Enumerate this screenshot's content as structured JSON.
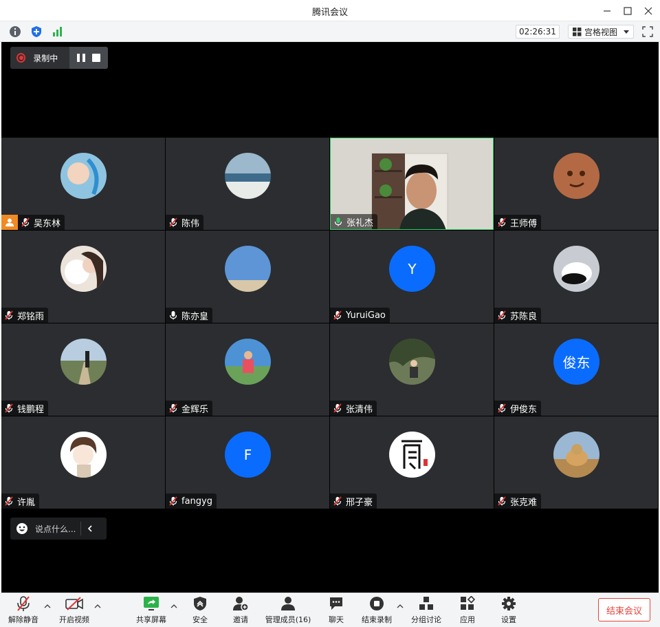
{
  "window": {
    "title": "腾讯会议"
  },
  "infobar": {
    "timer": "02:26:31",
    "view_mode": "宫格视图"
  },
  "recording": {
    "label": "录制中"
  },
  "participants": [
    {
      "name": "吴东林",
      "mic": "muted",
      "host": true,
      "avatar": "baby-photo",
      "color": "#7fb6d6"
    },
    {
      "name": "陈伟",
      "mic": "muted",
      "avatar": "ocean-photo",
      "color": "#6a8aa0"
    },
    {
      "name": "张礼杰",
      "mic": "active",
      "video": true,
      "avatar": "webcam-video",
      "color": "#c8c4bc"
    },
    {
      "name": "王师傅",
      "mic": "muted",
      "avatar": "cartoon-face",
      "color": "#b66a45"
    },
    {
      "name": "郑铭雨",
      "mic": "muted",
      "avatar": "girl-with-dog-photo",
      "color": "#e8ddd2"
    },
    {
      "name": "陈亦皇",
      "mic": "on",
      "avatar": "beach-sky-photo",
      "color": "#6f9fd8"
    },
    {
      "name": "YuruiGao",
      "mic": "muted",
      "avatar_letter": "Y",
      "color": "#0a6cff"
    },
    {
      "name": "苏陈良",
      "mic": "muted",
      "avatar": "panda-photo",
      "color": "#9aa0a8"
    },
    {
      "name": "钱鹏程",
      "mic": "muted",
      "avatar": "path-photo",
      "color": "#7a8a6a"
    },
    {
      "name": "金辉乐",
      "mic": "muted",
      "avatar": "person-photo",
      "color": "#4a8fd0"
    },
    {
      "name": "张清伟",
      "mic": "muted",
      "avatar": "tree-photo",
      "color": "#5a6a50"
    },
    {
      "name": "伊俊东",
      "mic": "muted",
      "avatar_letter": "俊东",
      "color": "#0a6cff"
    },
    {
      "name": "许胤",
      "mic": "muted",
      "avatar": "cartoon-boy",
      "color": "#f2efe9"
    },
    {
      "name": "fangyg",
      "mic": "muted",
      "avatar_letter": "F",
      "color": "#0a6cff"
    },
    {
      "name": "邢子豪",
      "mic": "muted",
      "avatar": "calligraphy-seal",
      "color": "#ffffff"
    },
    {
      "name": "张克难",
      "mic": "muted",
      "avatar": "cheetah-photo",
      "color": "#c69a5a"
    }
  ],
  "chat": {
    "placeholder": "说点什么..."
  },
  "toolbar": {
    "unmute": "解除静音",
    "start_video": "开启视频",
    "share_screen": "共享屏幕",
    "security": "安全",
    "invite": "邀请",
    "manage_members": "管理成员(16)",
    "chat": "聊天",
    "end_recording": "结束录制",
    "breakout": "分组讨论",
    "apps": "应用",
    "settings": "设置",
    "end_meeting": "结束会议"
  },
  "colors": {
    "accent_blue": "#0a6cff",
    "record_red": "#e33333",
    "speaking_green": "#2fd36a",
    "end_red": "#e6433a",
    "host_orange": "#f08a24"
  }
}
